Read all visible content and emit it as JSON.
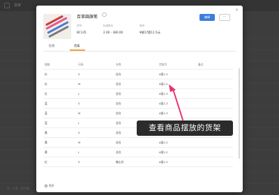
{
  "app": {
    "title": "货架",
    "footer": "共 · 0 条 · 共10条"
  },
  "modal": {
    "title": "百草園旗笔",
    "meta": [
      {
        "key": "货号",
        "value": "BC135"
      },
      {
        "key": "标准售价",
        "value": "2.00 - 380.00"
      },
      {
        "key": "库存",
        "value": "¥總17套11.5元"
      }
    ],
    "primary_button": "编辑",
    "more_button": "···",
    "tabs": [
      {
        "label": "信息"
      },
      {
        "label": "货架"
      }
    ],
    "active_tab": 1,
    "table": {
      "headers": [
        "规格",
        "尺码",
        "仓库",
        "货架号",
        "备注"
      ],
      "rows": [
        [
          "红",
          "S",
          "总仓",
          "A组1-2",
          ""
        ],
        [
          "红",
          "M",
          "总仓",
          "A组1-2",
          ""
        ],
        [
          "红",
          "L",
          "总仓",
          "A组1-3",
          ""
        ],
        [
          "蓝",
          "S",
          "总仓",
          "A组1-3",
          ""
        ],
        [
          "蓝",
          "M",
          "总仓",
          "A组1-3",
          ""
        ],
        [
          "蓝",
          "L",
          "总仓",
          "A组1-2",
          ""
        ],
        [
          "黄",
          "S",
          "总仓",
          "A组1-2",
          ""
        ],
        [
          "黄",
          "M",
          "总仓",
          "A组1-2",
          ""
        ],
        [
          "黄",
          "L",
          "总仓",
          "A组1-2",
          ""
        ],
        [
          "红",
          "S",
          "佛山仓",
          "A组1-2",
          ""
        ]
      ]
    },
    "load_more": "更多"
  },
  "annotation": {
    "text": "查看商品摆放的货架",
    "arrow_color": "#e8336b"
  }
}
